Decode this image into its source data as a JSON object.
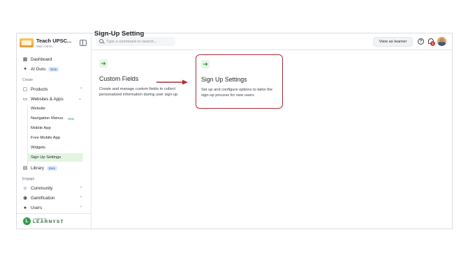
{
  "sidebar": {
    "brand_name": "Teach UPSC...",
    "brand_role": "Main Admin",
    "items": [
      {
        "label": "Dashboard"
      },
      {
        "label": "AI Guru",
        "badge": "Beta"
      },
      {
        "section": "Create"
      },
      {
        "label": "Products"
      },
      {
        "label": "Websites & Apps"
      },
      {
        "label": "Library",
        "badge": "Beta"
      },
      {
        "section": "Engage"
      },
      {
        "label": "Community"
      },
      {
        "label": "Gamification"
      },
      {
        "label": "Users"
      }
    ],
    "sub_items": [
      {
        "label": "Website"
      },
      {
        "label": "Navigation Menus",
        "badge": "New"
      },
      {
        "label": "Mobile App"
      },
      {
        "label": "Free Mobile App"
      },
      {
        "label": "Widgets"
      },
      {
        "label": "Sign Up Settings",
        "active": true
      }
    ],
    "footer": {
      "small": "POWERED BY",
      "word": "LEARNYST"
    }
  },
  "topbar": {
    "search_placeholder": "Type a command or search...",
    "view_as_learner": "View as learner",
    "notifications_count": "1"
  },
  "main": {
    "title": "Sign-Up Setting",
    "cards": [
      {
        "title": "Custom Fields",
        "description": "Create and manage custom fields to collect personalized information during user sign-up"
      },
      {
        "title": "Sign Up Settings",
        "description": "Set up and configure options to tailor the sign-up process for new users"
      }
    ]
  },
  "colors": {
    "accent": "#2e9b4a",
    "highlight_border": "#b02b34",
    "arrow": "#b02b34"
  }
}
